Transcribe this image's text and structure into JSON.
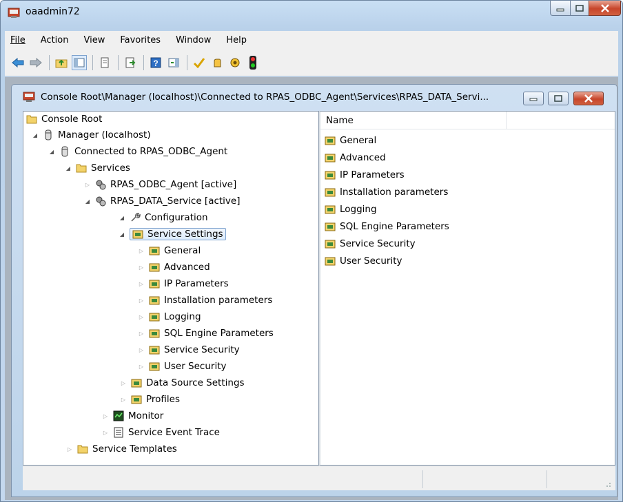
{
  "window": {
    "title": "oaadmin72"
  },
  "menu": {
    "items": [
      "File",
      "Action",
      "View",
      "Favorites",
      "Window",
      "Help"
    ]
  },
  "toolbar": {
    "buttons": [
      "back-icon",
      "forward-icon",
      "up-folder-icon",
      "show-hide-tree-icon",
      "copy-icon",
      "export-list-icon",
      "help-icon",
      "show-action-pane-icon",
      "checkmark-icon",
      "hand-icon",
      "gear-bug-icon",
      "traffic-light-icon"
    ]
  },
  "child": {
    "title": "Console Root\\Manager (localhost)\\Connected to RPAS_ODBC_Agent\\Services\\RPAS_DATA_Servi..."
  },
  "tree": {
    "nodes": [
      {
        "label": "Console Root"
      },
      {
        "label": "Manager (localhost)"
      },
      {
        "label": "Connected to RPAS_ODBC_Agent"
      },
      {
        "label": "Services"
      },
      {
        "label": "RPAS_ODBC_Agent [active]"
      },
      {
        "label": "RPAS_DATA_Service [active]"
      },
      {
        "label": "Configuration"
      },
      {
        "label": "Service Settings"
      },
      {
        "label": "General"
      },
      {
        "label": "Advanced"
      },
      {
        "label": "IP Parameters"
      },
      {
        "label": "Installation parameters"
      },
      {
        "label": "Logging"
      },
      {
        "label": "SQL Engine Parameters"
      },
      {
        "label": "Service Security"
      },
      {
        "label": "User Security"
      },
      {
        "label": "Data Source Settings"
      },
      {
        "label": "Profiles"
      },
      {
        "label": "Monitor"
      },
      {
        "label": "Service Event Trace"
      },
      {
        "label": "Service Templates"
      }
    ]
  },
  "list": {
    "column_header": "Name",
    "items": [
      "General",
      "Advanced",
      "IP Parameters",
      "Installation parameters",
      "Logging",
      "SQL Engine Parameters",
      "Service Security",
      "User Security"
    ]
  },
  "colors": {
    "selection_border": "#7da2ce",
    "title_gradient": "#c9dff4",
    "close_red": "#c7452b"
  }
}
